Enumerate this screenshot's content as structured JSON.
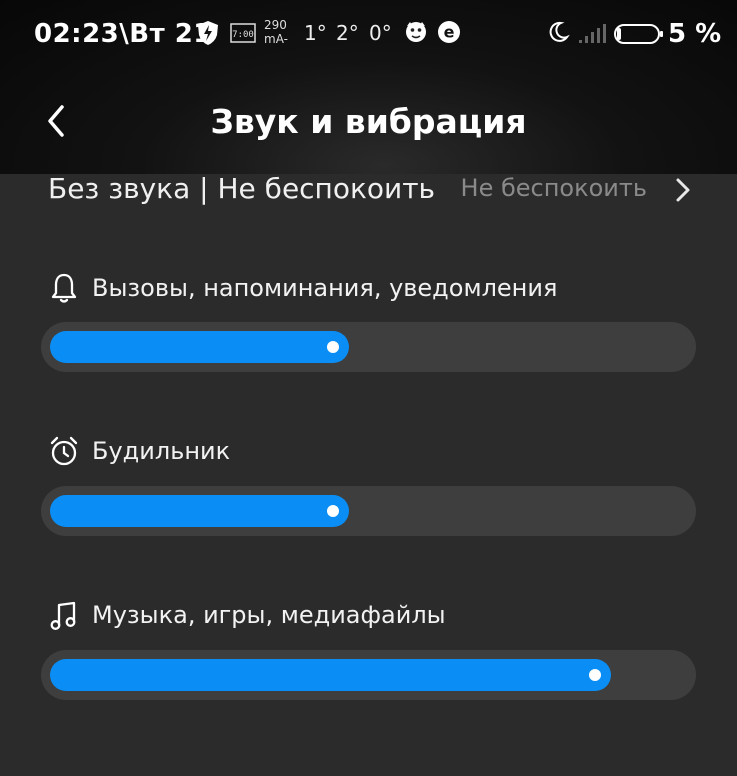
{
  "status_bar": {
    "time": "02:23\\Вт 21",
    "rate_top": "290",
    "rate_bottom": "mA-",
    "temp_1": "1°",
    "temp_2": "2°",
    "temp_3": "0°",
    "battery_text": "5 %",
    "battery_level": 0.05,
    "icons": [
      "bolt-shield-icon",
      "clock-status-icon",
      "bulldog-icon",
      "e-app-icon",
      "moon-icon",
      "signal-icon",
      "battery-icon"
    ]
  },
  "header": {
    "title": "Звук и вибрация",
    "back_icon": "chevron-left-icon"
  },
  "dnd": {
    "label": "Без звука | Не беспокоить",
    "value": "Не беспокоить"
  },
  "volumes": [
    {
      "label": "Вызовы, напоминания, уведомления",
      "icon": "bell-icon",
      "level": 0.47
    },
    {
      "label": "Будильник",
      "icon": "alarm-clock-icon",
      "level": 0.47
    },
    {
      "label": "Музыка, игры, медиафайлы",
      "icon": "music-note-icon",
      "level": 0.88
    }
  ],
  "colors": {
    "accent": "#0a8ef6",
    "track": "#3e3e3e",
    "background": "#2b2b2b"
  }
}
